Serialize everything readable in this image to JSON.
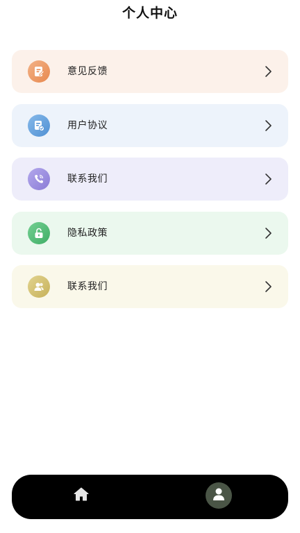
{
  "header": {
    "title": "个人中心"
  },
  "menu": {
    "items": [
      {
        "label": "意见反馈",
        "icon": "feedback-icon",
        "bg": "#fcf1ea",
        "icon_color": "#ec9a63"
      },
      {
        "label": "用户协议",
        "icon": "agreement-icon",
        "bg": "#edf3fb",
        "icon_color": "#5f9edc"
      },
      {
        "label": "联系我们",
        "icon": "phone-icon",
        "bg": "#eeedfa",
        "icon_color": "#9c8ee0"
      },
      {
        "label": "隐私政策",
        "icon": "lock-icon",
        "bg": "#ebf8ee",
        "icon_color": "#4fbb74"
      },
      {
        "label": "联系我们",
        "icon": "contacts-icon",
        "bg": "#faf8ea",
        "icon_color": "#d2c070"
      }
    ]
  },
  "tabbar": {
    "tabs": [
      {
        "icon": "home-icon"
      },
      {
        "icon": "profile-icon",
        "active_bg": "#4a5546"
      }
    ]
  }
}
